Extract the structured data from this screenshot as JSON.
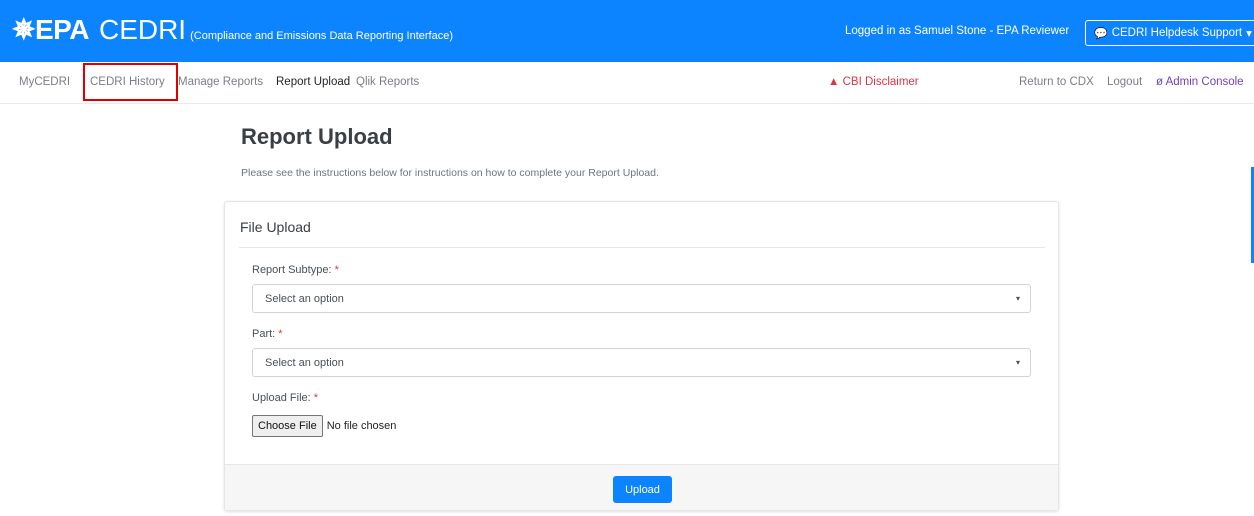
{
  "header": {
    "logo": "✵EPA",
    "app_name": "CEDRI",
    "subtitle": "(Compliance and Emissions Data Reporting Interface)",
    "logged_in": "Logged in as Samuel Stone - EPA Reviewer",
    "helpdesk_label": "CEDRI Helpdesk Support",
    "helpdesk_caret": "▾",
    "chat_icon": "chat-icon"
  },
  "nav": {
    "left": [
      "MyCEDRI",
      "CEDRI History",
      "Manage Reports",
      "Report Upload",
      "Qlik Reports"
    ],
    "active": "Report Upload",
    "highlighted": "CEDRI History",
    "cbi_label": "CBI Disclaimer",
    "cbi_icon": "▲",
    "return_label": "Return to CDX",
    "logout_label": "Logout",
    "admin_icon": "ø",
    "admin_label": "Admin Console"
  },
  "page": {
    "title": "Report Upload",
    "description": "Please see the instructions below for instructions on how to complete your Report Upload."
  },
  "form": {
    "card_title": "File Upload",
    "subtype_label": "Report Subtype:",
    "subtype_value": "Select an option",
    "part_label": "Part:",
    "part_value": "Select an option",
    "upload_label": "Upload File:",
    "required_marker": "*",
    "choose_file": "Choose File",
    "file_status": "No file chosen",
    "upload_button": "Upload",
    "select_caret": "▾"
  },
  "colors": {
    "brand_blue": "#0d84ff",
    "danger": "#dc3545",
    "admin_purple": "#6f42c1",
    "highlight_red": "#e00000"
  }
}
